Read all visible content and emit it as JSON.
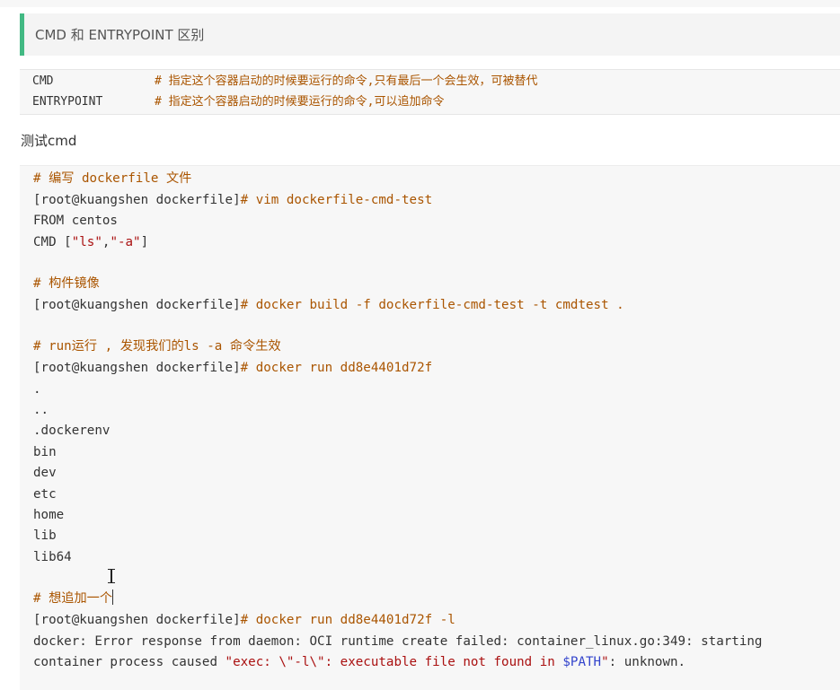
{
  "quote": {
    "text": "CMD 和 ENTRYPOINT 区别"
  },
  "table": {
    "rows": [
      {
        "key": "CMD",
        "comment": "# 指定这个容器启动的时候要运行的命令,只有最后一个会生效，可被替代"
      },
      {
        "key": "ENTRYPOINT",
        "comment": "# 指定这个容器启动的时候要运行的命令,可以追加命令"
      }
    ]
  },
  "section": {
    "heading": "测试cmd"
  },
  "code": {
    "l1_comment": "# 编写 dockerfile 文件",
    "l2_prompt": "[root@kuangshen dockerfile]",
    "l2_cmd": "# vim dockerfile-cmd-test",
    "l3": "FROM centos",
    "l4_pre": "CMD [",
    "l4_s1": "\"ls\"",
    "l4_mid": ",",
    "l4_s2": "\"-a\"",
    "l4_post": "]",
    "l6_comment": "# 构件镜像",
    "l7_prompt": "[root@kuangshen dockerfile]",
    "l7_cmd": "# docker build -f dockerfile-cmd-test -t cmdtest .",
    "l9_comment": "# run运行 , 发现我们的ls -a 命令生效",
    "l10_prompt": "[root@kuangshen dockerfile]",
    "l10_cmd": "# docker run dd8e4401d72f",
    "out": [
      ".",
      "..",
      ".dockerenv",
      "bin",
      "dev",
      "etc",
      "home",
      "lib",
      "lib64"
    ],
    "l21_comment": "# 想追加一个",
    "l22_prompt": "[root@kuangshen dockerfile]",
    "l22_cmd": "# docker run dd8e4401d72f -l",
    "l23": "docker: Error response from daemon: OCI runtime create failed: container_linux.go:349: starting",
    "l24_pre": "container process caused ",
    "l24_str": "\"exec: \\\"-l\\\": executable file not found in ",
    "l24_var": "$PATH",
    "l24_str2": "\"",
    "l24_post": ": unknown."
  }
}
